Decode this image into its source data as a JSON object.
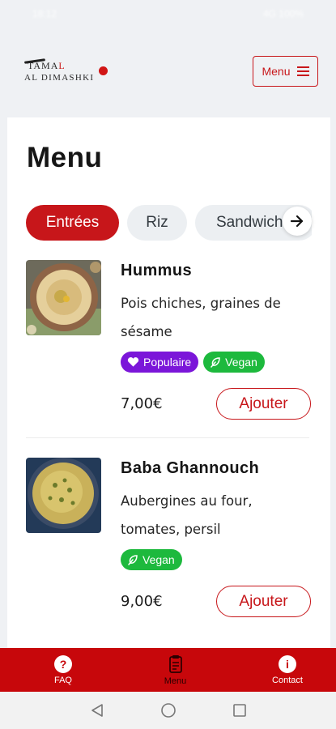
{
  "status_bar": {
    "time": "18:12",
    "right": "4G 100%"
  },
  "header": {
    "logo_line1_a": "TAMA",
    "logo_line1_b": "L",
    "logo_line2": "AL DIMASHKI",
    "menu_button_label": "Menu"
  },
  "page": {
    "title": "Menu"
  },
  "categories": [
    {
      "label": "Entrées",
      "active": true
    },
    {
      "label": "Riz",
      "active": false
    },
    {
      "label": "Sandwichs",
      "active": false
    }
  ],
  "dishes": [
    {
      "name": "Hummus",
      "description": "Pois chiches, graines de sésame",
      "badges": [
        {
          "label": "Populaire",
          "icon": "heart-icon"
        },
        {
          "label": "Vegan",
          "icon": "leaf-icon"
        }
      ],
      "price": "7,00€",
      "add_label": "Ajouter"
    },
    {
      "name": "Baba Ghannouch",
      "description": "Aubergines au four, tomates, persil",
      "badges": [
        {
          "label": "Vegan",
          "icon": "leaf-icon"
        }
      ],
      "price": "9,00€",
      "add_label": "Ajouter"
    }
  ],
  "bottom_nav": [
    {
      "label": "FAQ",
      "icon": "question-icon"
    },
    {
      "label": "Menu",
      "icon": "menu-doc-icon"
    },
    {
      "label": "Contact",
      "icon": "info-icon"
    }
  ],
  "colors": {
    "brand_red": "#c7161a",
    "popular_purple": "#7b16d9",
    "vegan_green": "#1db93d",
    "background": "#eff1f4"
  }
}
